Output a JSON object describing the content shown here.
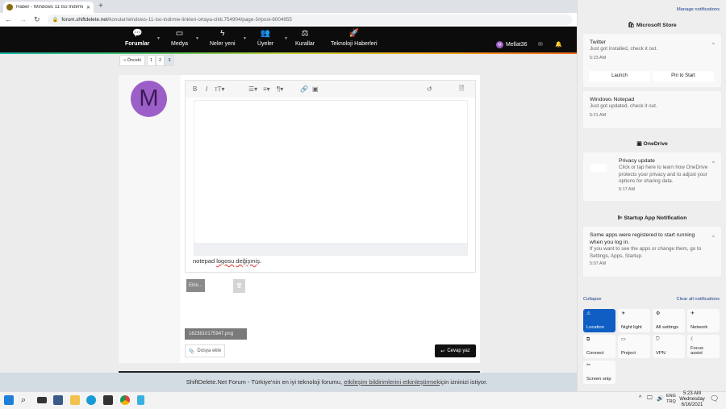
{
  "browser": {
    "tab_title": "Haber - Windows 11 Iso Indirme",
    "url_domain": "forum.shiftdelete.net",
    "url_path": "/konular/windows-11-iso-indirme-linkleri-ortaya-cikti.754904/page-3#post-6004955"
  },
  "nav": {
    "items": [
      {
        "label": "Forumlar",
        "icon": "chat-icon"
      },
      {
        "label": "Medya",
        "icon": "media-icon"
      },
      {
        "label": "Neler yeni",
        "icon": "bolt-icon"
      },
      {
        "label": "Üyeler",
        "icon": "users-icon"
      },
      {
        "label": "Kurallar",
        "icon": "scales-icon"
      },
      {
        "label": "Teknoloji Haberleri",
        "icon": "rocket-icon"
      }
    ],
    "user": "Mellat36",
    "avatar_letter": "M"
  },
  "pagination": {
    "prev": "« Önceki",
    "pages": [
      "1",
      "2",
      "3"
    ],
    "current": "3"
  },
  "post": {
    "avatar_letter": "M",
    "avatar_color": "#9c5fc8",
    "message_parts": [
      "notepad ",
      "logosu",
      " ",
      "değişmiş",
      "."
    ],
    "insert_button": "Ekle...",
    "attachment_name": "1623810175947.png",
    "attach_button": "Dosya ekle",
    "reply_button": "Cevap yaz"
  },
  "cookie_bar": {
    "text_before": "ShiftDelete.Net Forum - Türkiye'nin en iyi teknoloji forumu, ",
    "link": "etkileşim bildirimlerini etkinleştirmek ",
    "text_after": "için izninizi istiyor."
  },
  "notifications": {
    "manage": "Manage notifications",
    "groups": [
      {
        "app": "Microsoft Store",
        "items": [
          {
            "title": "Twitter",
            "body": "Just got installed, check it out.",
            "time": "5:23 AM",
            "actions": [
              "Launch",
              "Pin to Start"
            ]
          },
          {
            "title": "Windows Notepad",
            "body": "Just got updated, check it out.",
            "time": "5:21 AM"
          }
        ]
      },
      {
        "app": "OneDrive",
        "items": [
          {
            "title": "Privacy update",
            "body": "Click or tap here to learn how OneDrive protects your privacy and to adjust your options for sharing data.",
            "time": "5:17 AM"
          }
        ]
      },
      {
        "app": "Startup App Notification",
        "items": [
          {
            "title": "Some apps were registered to start running when you log in.",
            "body": "If you want to see the apps or change them, go to Settings, Apps, Startup.",
            "time": "5:07 AM"
          }
        ]
      }
    ],
    "collapse": "Collapse",
    "clear_all": "Clear all notifications",
    "quick_actions": [
      {
        "label": "Location",
        "active": true,
        "icon": "location-icon"
      },
      {
        "label": "Night light",
        "active": false,
        "icon": "brightness-icon"
      },
      {
        "label": "All settings",
        "active": false,
        "icon": "gear-icon"
      },
      {
        "label": "Network",
        "active": false,
        "icon": "network-icon"
      },
      {
        "label": "Connect",
        "active": false,
        "icon": "connect-icon"
      },
      {
        "label": "Project",
        "active": false,
        "icon": "project-icon"
      },
      {
        "label": "VPN",
        "active": false,
        "icon": "vpn-icon"
      },
      {
        "label": "Focus assist",
        "active": false,
        "icon": "moon-icon"
      },
      {
        "label": "Screen snip",
        "active": false,
        "icon": "snip-icon"
      }
    ],
    "accent": "#0e5ec4"
  },
  "taskbar": {
    "lang1": "ENG",
    "lang2": "TRQ",
    "time": "5:23 AM",
    "day": "Wednesday",
    "date": "6/16/2021"
  }
}
